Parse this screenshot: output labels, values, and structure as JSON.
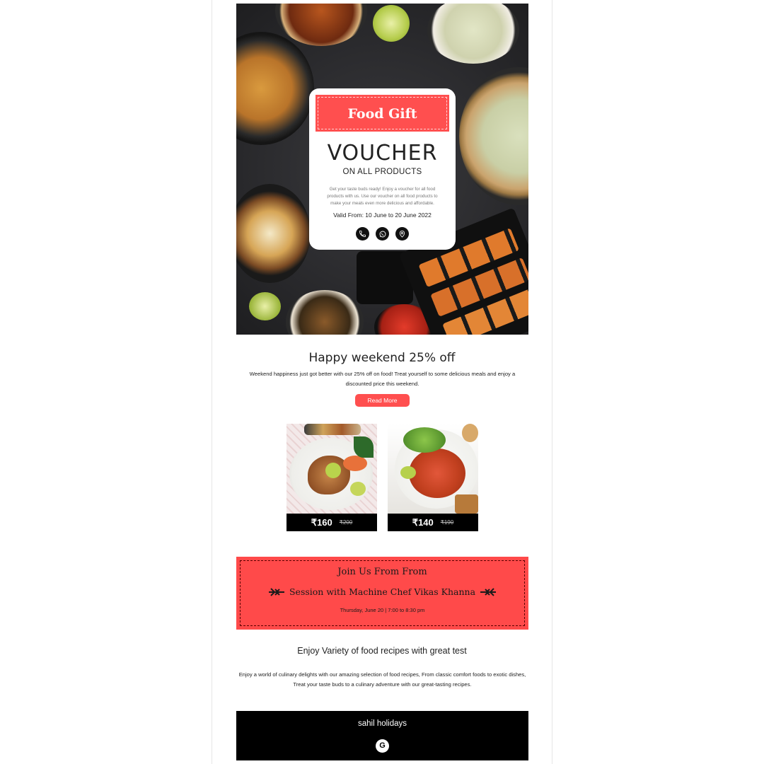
{
  "hero": {
    "ribbon_text": "Food Gift",
    "title": "VOUCHER",
    "subtitle": "ON ALL PRODUCTS",
    "description": "Get your taste buds ready! Enjoy a voucher for all food products with us. Use our voucher on all food products to make your meals even more delicious and affordable.",
    "valid": "Valid From: 10 June to 20 June 2022",
    "icons": [
      "phone-icon",
      "whatsapp-icon",
      "location-pin-icon"
    ]
  },
  "offer": {
    "title": "Happy weekend 25% off",
    "text": "Weekend happiness just got better with our 25% off on food! Treat yourself to some delicious meals and enjoy a discounted price this weekend.",
    "button": "Read More"
  },
  "products": [
    {
      "price": "₹160",
      "old_price": "₹200"
    },
    {
      "price": "₹140",
      "old_price": "₹190"
    }
  ],
  "event": {
    "line1": "Join Us From From",
    "line2": "Session with Machine Chef Vikas Khanna",
    "line3": "Thursday, June 20 | 7:00 to 8:30 pm"
  },
  "recipes": {
    "title": "Enjoy Variety of food recipes with great test",
    "text": "Enjoy a world of culinary delights with our amazing selection of food recipes, From classic comfort foods to exotic dishes, Treat your taste buds to a culinary adventure with our great-tasting recipes."
  },
  "footer": {
    "brand": "sahil holidays",
    "social_icon": "G"
  },
  "colors": {
    "accent": "#ff4f4f",
    "dark": "#000000"
  }
}
